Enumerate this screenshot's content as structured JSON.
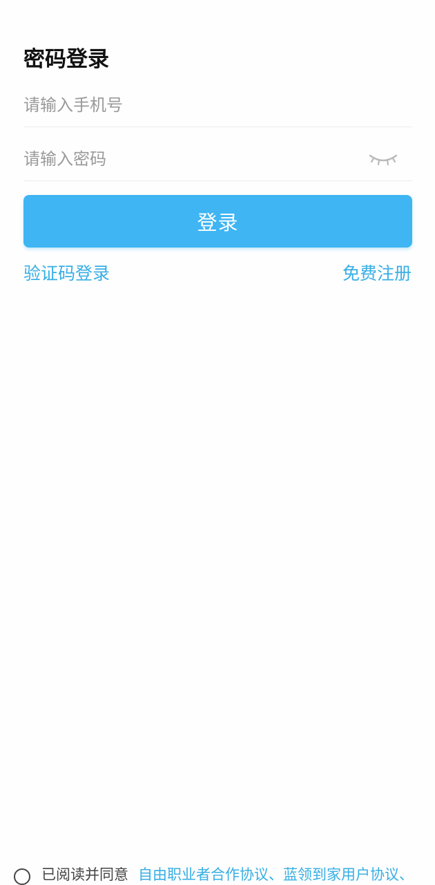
{
  "page": {
    "title": "密码登录"
  },
  "form": {
    "phone_placeholder": "请输入手机号",
    "password_placeholder": "请输入密码",
    "password_toggle_icon": "eye-closed-icon",
    "login_label": "登录"
  },
  "links": {
    "sms_login": "验证码登录",
    "register": "免费注册"
  },
  "agreement": {
    "checked": false,
    "prefix": "已阅读并同意",
    "items": [
      "自由职业者合作协议",
      "蓝领到家用户协议"
    ],
    "separator": "、"
  },
  "colors": {
    "accent": "#3fb5f3",
    "link": "#37aee4",
    "title": "#111111",
    "placeholder": "#9a9a9a",
    "divider": "#ececec"
  }
}
